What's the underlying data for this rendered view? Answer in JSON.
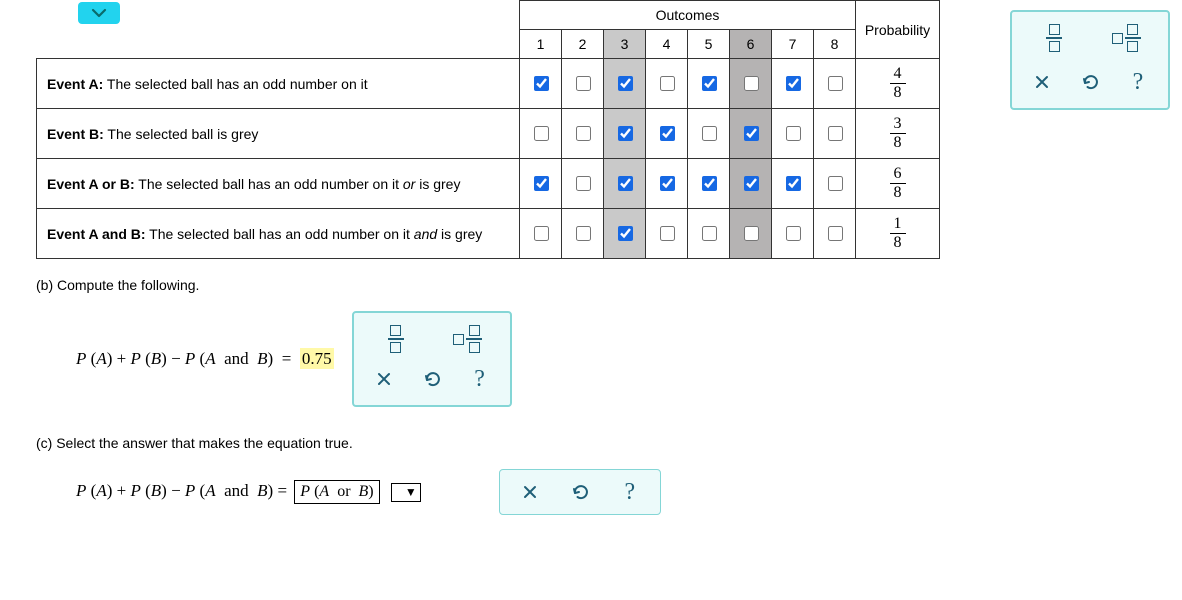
{
  "table": {
    "outcomes_label": "Outcomes",
    "probability_label": "Probability",
    "columns": [
      "1",
      "2",
      "3",
      "4",
      "5",
      "6",
      "7",
      "8"
    ],
    "shaded": [
      3,
      6
    ],
    "rows": [
      {
        "id": "event-a",
        "label_strong": "Event A:",
        "label_rest": " The selected ball has an odd number on it",
        "checks": [
          true,
          false,
          true,
          false,
          true,
          false,
          true,
          false
        ],
        "prob_num": "4",
        "prob_den": "8"
      },
      {
        "id": "event-b",
        "label_strong": "Event B:",
        "label_rest": " The selected ball is grey",
        "checks": [
          false,
          false,
          true,
          true,
          false,
          true,
          false,
          false
        ],
        "prob_num": "3",
        "prob_den": "8"
      },
      {
        "id": "event-a-or-b",
        "label_strong": "Event A or B:",
        "label_rest_html": " The selected ball has an odd number on it <i>or</i> is grey",
        "checks": [
          true,
          false,
          true,
          true,
          true,
          true,
          true,
          false
        ],
        "prob_num": "6",
        "prob_den": "8"
      },
      {
        "id": "event-a-and-b",
        "label_strong": "Event A and B:",
        "label_rest_html": " The selected ball has an odd number on it <i>and</i> is grey",
        "checks": [
          false,
          false,
          true,
          false,
          false,
          false,
          false,
          false
        ],
        "prob_num": "1",
        "prob_den": "8"
      }
    ]
  },
  "partB": {
    "prompt": "(b) Compute the following.",
    "eq_lhs": "P (A) + P (B) − P (A  and  B)",
    "eq_rhs": "0.75"
  },
  "partC": {
    "prompt": "(c) Select the answer that makes the equation true.",
    "eq_lhs": "P (A) + P (B) − P (A  and  B) =",
    "selected": "P (A  or  B)"
  }
}
